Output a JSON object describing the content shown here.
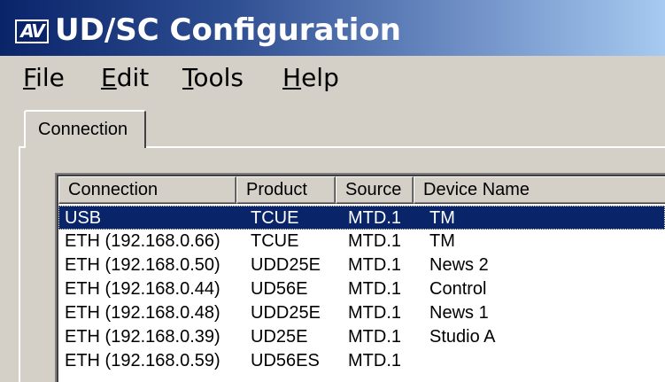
{
  "window": {
    "logo_text": "AV",
    "title": "UD/SC Configuration"
  },
  "menu": {
    "items": [
      {
        "mnemonic": "F",
        "rest": "ile"
      },
      {
        "mnemonic": "E",
        "rest": "dit"
      },
      {
        "mnemonic": "T",
        "rest": "ools"
      },
      {
        "mnemonic": "H",
        "rest": "elp"
      }
    ]
  },
  "tabs": [
    {
      "label": "Connection",
      "selected": true
    }
  ],
  "list": {
    "columns": [
      "Connection",
      "Product",
      "Source",
      "Device Name"
    ],
    "rows": [
      {
        "connection": "USB",
        "product": "TCUE",
        "source": "MTD.1",
        "device": "TM",
        "selected": true
      },
      {
        "connection": "ETH (192.168.0.66)",
        "product": "TCUE",
        "source": "MTD.1",
        "device": "TM"
      },
      {
        "connection": "ETH (192.168.0.50)",
        "product": "UDD25E",
        "source": "MTD.1",
        "device": "News 2"
      },
      {
        "connection": "ETH (192.168.0.44)",
        "product": "UD56E",
        "source": "MTD.1",
        "device": "Control"
      },
      {
        "connection": "ETH (192.168.0.48)",
        "product": "UDD25E",
        "source": "MTD.1",
        "device": "News 1"
      },
      {
        "connection": "ETH (192.168.0.39)",
        "product": "UD25E",
        "source": "MTD.1",
        "device": "Studio A"
      },
      {
        "connection": "ETH (192.168.0.59)",
        "product": "UD56ES",
        "source": "MTD.1",
        "device": ""
      }
    ]
  },
  "colors": {
    "titlebar_start": "#0a246a",
    "titlebar_end": "#a6caf0",
    "selection": "#0a246a",
    "window_face": "#d4d0c8"
  }
}
